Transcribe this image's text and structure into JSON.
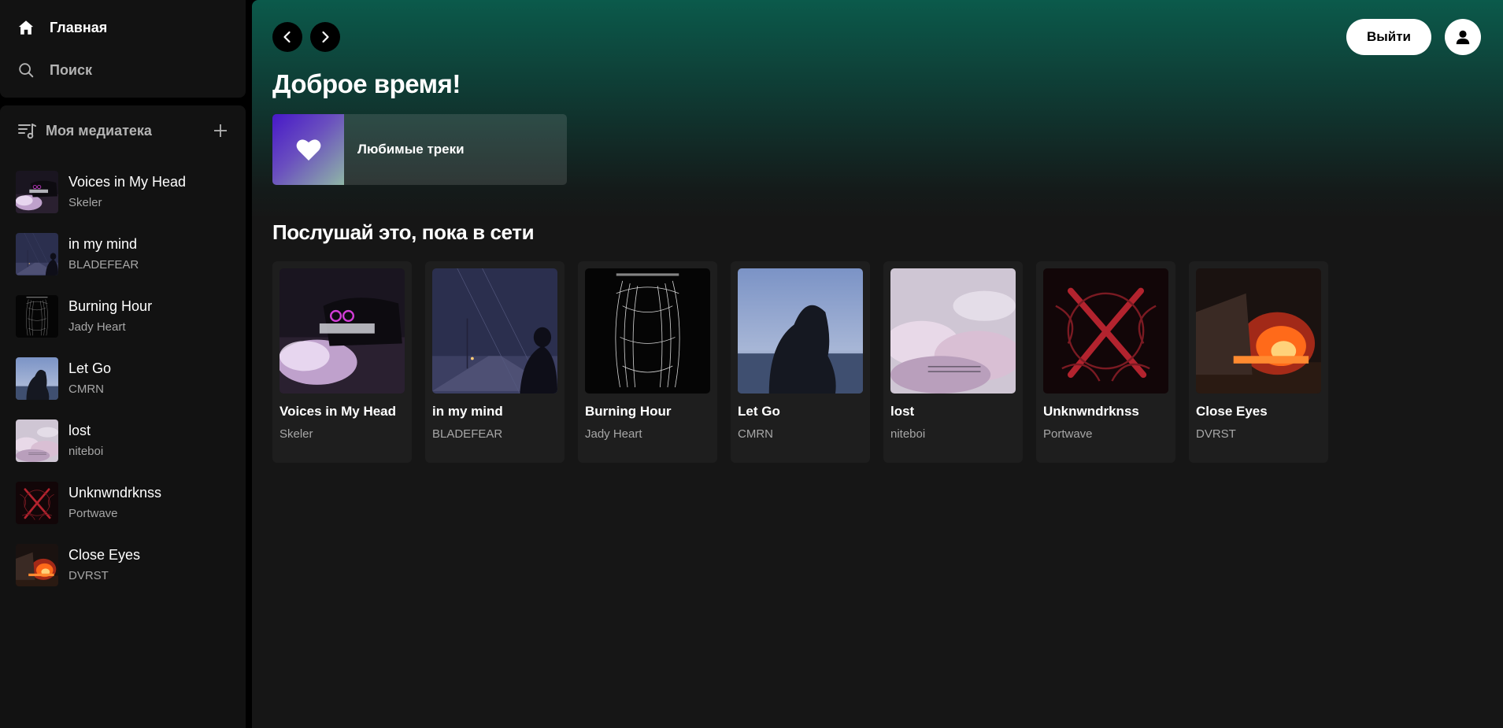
{
  "nav": {
    "home_label": "Главная",
    "search_label": "Поиск"
  },
  "library": {
    "title": "Моя медиатека",
    "items": [
      {
        "title": "Voices in My Head",
        "artist": "Skeler"
      },
      {
        "title": "in my mind",
        "artist": "BLADEFEAR"
      },
      {
        "title": "Burning Hour",
        "artist": "Jady Heart"
      },
      {
        "title": "Let Go",
        "artist": "CMRN"
      },
      {
        "title": "lost",
        "artist": "niteboi"
      },
      {
        "title": "Unknwndrknss",
        "artist": "Portwave"
      },
      {
        "title": "Close Eyes",
        "artist": "DVRST"
      }
    ]
  },
  "header": {
    "logout_label": "Выйти"
  },
  "main": {
    "greeting": "Доброе время!",
    "favorites_label": "Любимые треки",
    "section_title": "Послушай это, пока в сети",
    "cards": [
      {
        "title": "Voices in My Head",
        "artist": "Skeler"
      },
      {
        "title": "in my mind",
        "artist": "BLADEFEAR"
      },
      {
        "title": "Burning Hour",
        "artist": "Jady Heart"
      },
      {
        "title": "Let Go",
        "artist": "CMRN"
      },
      {
        "title": "lost",
        "artist": "niteboi"
      },
      {
        "title": "Unknwndrknss",
        "artist": "Portwave"
      },
      {
        "title": "Close Eyes",
        "artist": "DVRST"
      }
    ]
  },
  "colors": {
    "background": "#000000",
    "panel": "#121212",
    "main_bg": "#161616",
    "header_gradient_top": "#0b5a4b",
    "muted_text": "#a7a7a7"
  }
}
